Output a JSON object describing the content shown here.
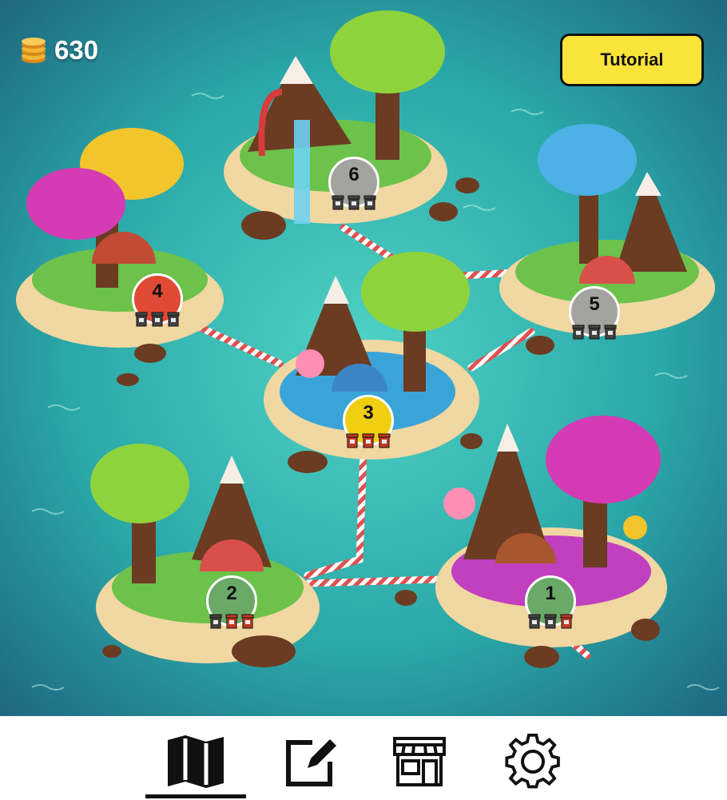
{
  "hud": {
    "coins": "630",
    "coin_icon": "coin-stack-icon",
    "tutorial_label": "Tutorial"
  },
  "levels": [
    {
      "number": "1",
      "status_color": "#6aa968",
      "pots": [
        "locked",
        "locked",
        "earned"
      ]
    },
    {
      "number": "2",
      "status_color": "#6aa968",
      "pots": [
        "locked",
        "earned",
        "earned"
      ]
    },
    {
      "number": "3",
      "status_color": "#f0cf12",
      "pots": [
        "earned",
        "earned",
        "earned"
      ]
    },
    {
      "number": "4",
      "status_color": "#e04a34",
      "pots": [
        "locked",
        "locked",
        "locked"
      ]
    },
    {
      "number": "5",
      "status_color": "#a3a3a0",
      "pots": [
        "locked",
        "locked",
        "locked"
      ]
    },
    {
      "number": "6",
      "status_color": "#a3a3a0",
      "pots": [
        "locked",
        "locked",
        "locked"
      ]
    }
  ],
  "nav": [
    {
      "icon": "map-icon",
      "active": true
    },
    {
      "icon": "edit-icon",
      "active": false
    },
    {
      "icon": "shop-icon",
      "active": false
    },
    {
      "icon": "gear-icon",
      "active": false
    }
  ],
  "colors": {
    "sea": "#2aa7a8",
    "sea_dark": "#1d5e7a",
    "sand": "#f1d7a2",
    "grass": "#6cc24a",
    "button": "#fbe43a"
  }
}
